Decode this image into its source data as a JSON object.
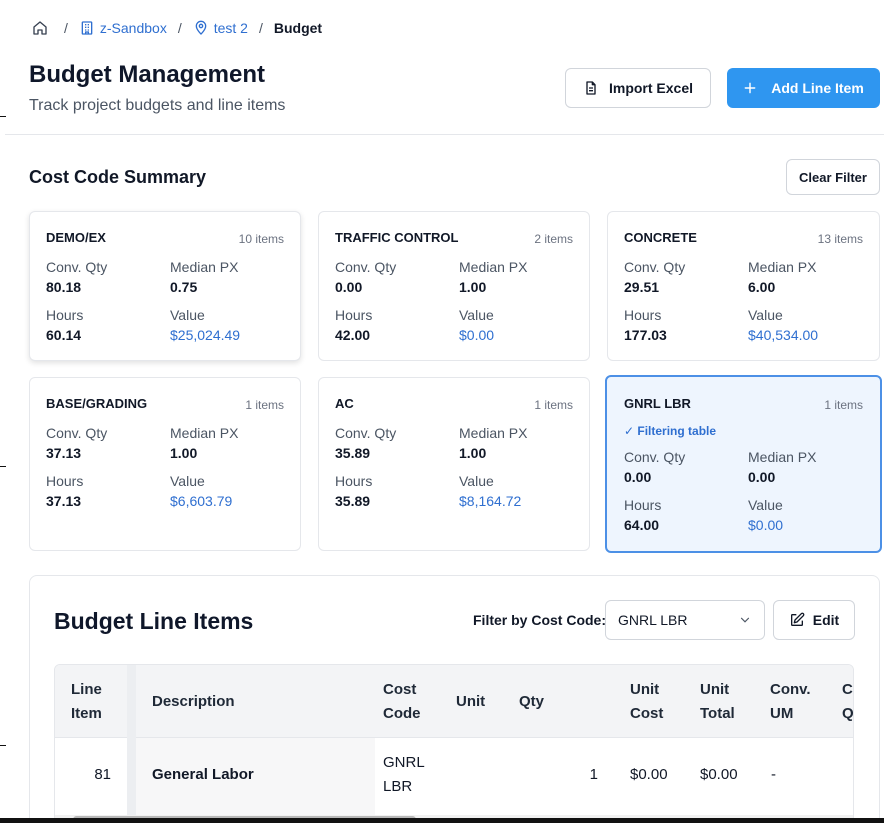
{
  "breadcrumb": {
    "items": [
      {
        "label": "z-Sandbox",
        "icon": "building-icon"
      },
      {
        "label": "test 2",
        "icon": "map-pin-icon"
      }
    ],
    "current": "Budget",
    "separator": "/"
  },
  "header": {
    "title": "Budget Management",
    "subtitle": "Track project budgets and line items",
    "import_label": "Import Excel",
    "add_label": "Add Line Item"
  },
  "summary": {
    "title": "Cost Code Summary",
    "clear_label": "Clear Filter",
    "labels": {
      "conv_qty": "Conv. Qty",
      "median_px": "Median PX",
      "hours": "Hours",
      "value": "Value"
    },
    "cards": [
      {
        "name": "DEMO/EX",
        "count": "10 items",
        "conv_qty": "80.18",
        "median_px": "0.75",
        "hours": "60.14",
        "value": "$25,024.49"
      },
      {
        "name": "TRAFFIC CONTROL",
        "count": "2 items",
        "conv_qty": "0.00",
        "median_px": "1.00",
        "hours": "42.00",
        "value": "$0.00"
      },
      {
        "name": "CONCRETE",
        "count": "13 items",
        "conv_qty": "29.51",
        "median_px": "6.00",
        "hours": "177.03",
        "value": "$40,534.00"
      },
      {
        "name": "BASE/GRADING",
        "count": "1 items",
        "conv_qty": "37.13",
        "median_px": "1.00",
        "hours": "37.13",
        "value": "$6,603.79"
      },
      {
        "name": "AC",
        "count": "1 items",
        "conv_qty": "35.89",
        "median_px": "1.00",
        "hours": "35.89",
        "value": "$8,164.72"
      },
      {
        "name": "GNRL LBR",
        "count": "1 items",
        "filter_note": "✓ Filtering table",
        "conv_qty": "0.00",
        "median_px": "0.00",
        "hours": "64.00",
        "value": "$0.00"
      }
    ]
  },
  "line_items": {
    "title": "Budget Line Items",
    "filter_label": "Filter by Cost Code:",
    "filter_value": "GNRL LBR",
    "edit_label": "Edit",
    "headers": {
      "line_item": [
        "Line",
        "Item"
      ],
      "description": "Description",
      "cost_code": [
        "Cost",
        "Code"
      ],
      "unit": "Unit",
      "qty": "Qty",
      "unit_cost": [
        "Unit",
        "Cost"
      ],
      "unit_total": [
        "Unit",
        "Total"
      ],
      "conv_um": [
        "Conv.",
        "UM"
      ],
      "conv_q": [
        "Co",
        "Q"
      ]
    },
    "rows": [
      {
        "line_item": "81",
        "description": "General Labor",
        "cost_code": [
          "GNRL",
          "LBR"
        ],
        "unit": "",
        "qty": "1",
        "unit_cost": "$0.00",
        "unit_total": "$0.00",
        "conv_um": "-"
      }
    ]
  },
  "colors": {
    "accent": "#2f96f0",
    "link": "#2f6fd0",
    "selected_bg": "#eef5fe",
    "selected_border": "#4c90e6"
  }
}
